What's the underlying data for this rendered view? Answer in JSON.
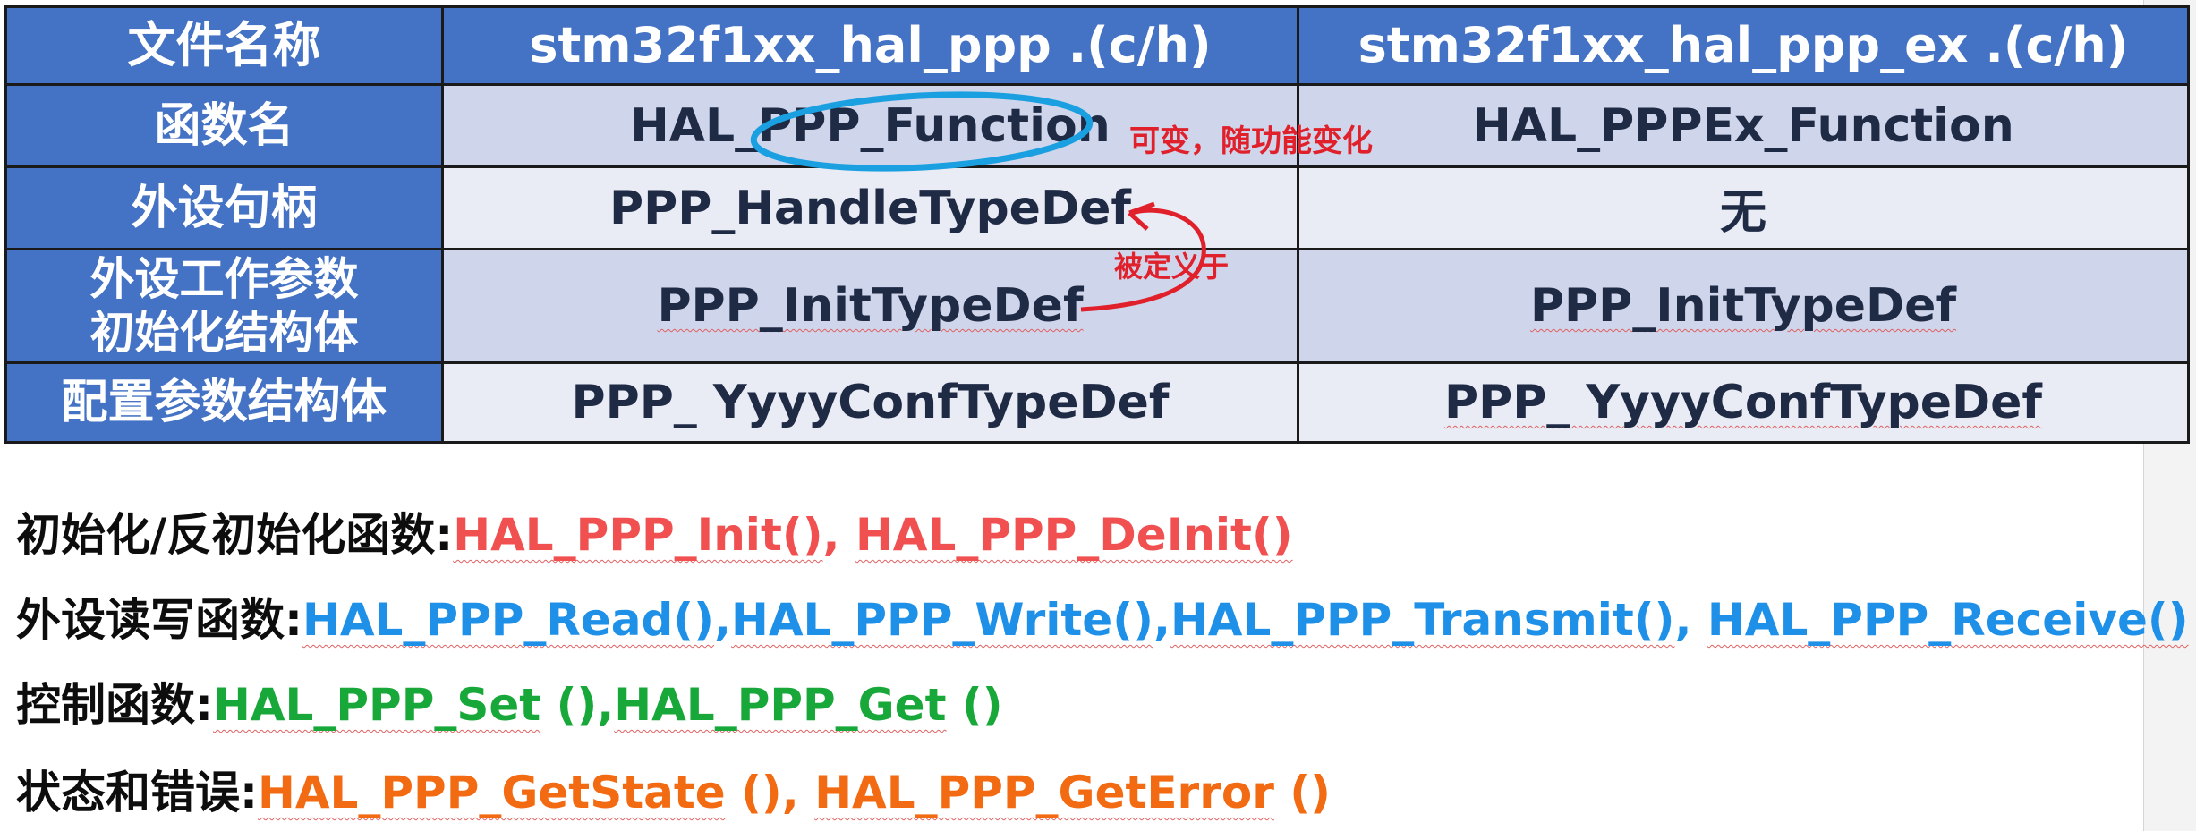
{
  "table": {
    "header": {
      "label": "文件名称",
      "col1": "stm32f1xx_hal_ppp .(c/h)",
      "col2": "stm32f1xx_hal_ppp_ex .(c/h)"
    },
    "rows": [
      {
        "label": "函数名",
        "col1": "HAL_PPP_Function",
        "col2": "HAL_PPPEx_Function"
      },
      {
        "label": "外设句柄",
        "col1": "PPP_HandleTypeDef",
        "col2": "无"
      },
      {
        "label_line1": "外设工作参数",
        "label_line2": "初始化结构体",
        "col1": "PPP_InitTypeDef",
        "col2": "PPP_InitTypeDef"
      },
      {
        "label": "配置参数结构体",
        "col1": "PPP_ YyyyConfTypeDef",
        "col2": "PPP_ YyyyConfTypeDef"
      }
    ]
  },
  "annotations": {
    "variable_note": "可变，随功能变化",
    "defined_in_note": "被定义于"
  },
  "lines": [
    {
      "label": "初始化/反初始化函数:",
      "funcs": [
        "HAL_PPP_Init()",
        ", ",
        "HAL_PPP_DeInit()"
      ]
    },
    {
      "label": "外设读写函数:",
      "funcs": [
        "HAL_PPP_Read()",
        ",",
        "HAL_PPP_Write()",
        ",",
        "HAL_PPP_Transmit()",
        ", ",
        "HAL_PPP_Receive()"
      ]
    },
    {
      "label": "控制函数:",
      "funcs": [
        "HAL_PPP_Set",
        " ()",
        ",",
        "HAL_PPP_Get",
        " ()"
      ]
    },
    {
      "label": "状态和错误:",
      "funcs": [
        "HAL_PPP_GetState",
        " ()",
        ", ",
        "HAL_PPP_GetError",
        " ()"
      ]
    }
  ],
  "colors": {
    "header_blue": "#4472c4",
    "band": "#cfd5ea",
    "band_light": "#e9ebf5",
    "init_red": "#f05050",
    "rw_blue": "#1e90e8",
    "ctrl_green": "#18a83a",
    "state_orange": "#f26b12",
    "annotation_red": "#e0202a",
    "highlight_circle": "#1aa0e0"
  }
}
